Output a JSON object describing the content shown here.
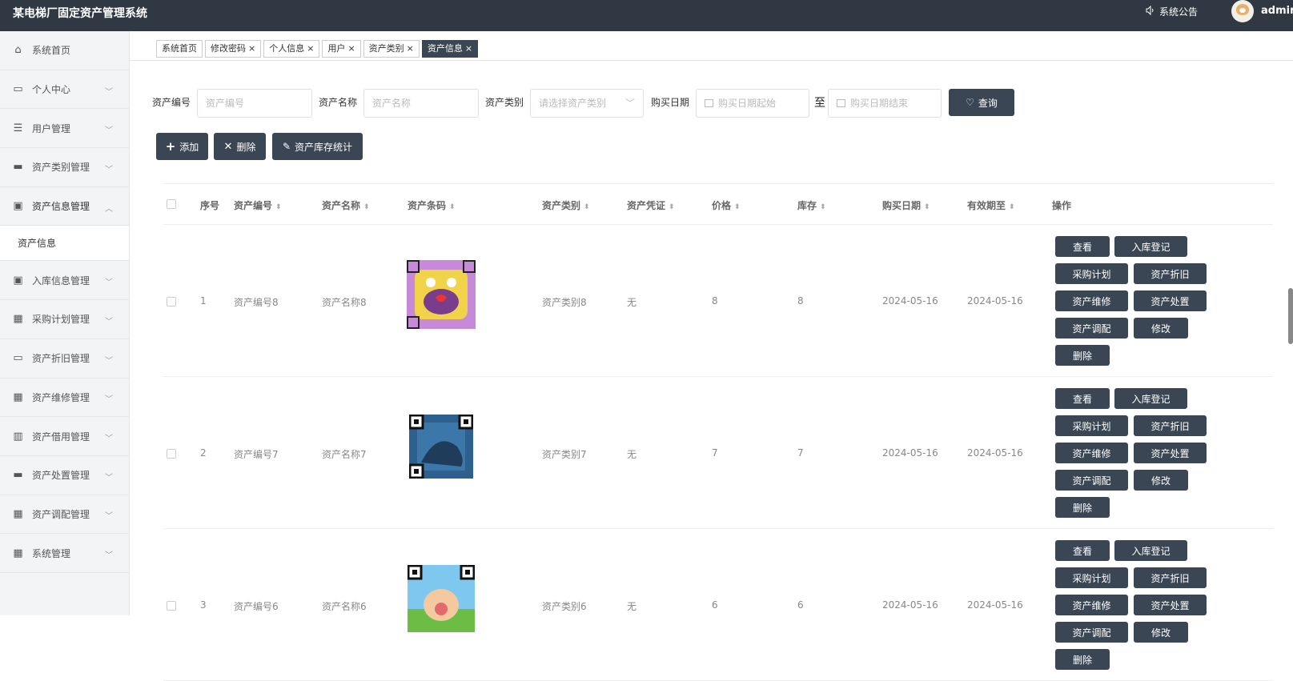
{
  "app_title": "某电梯厂固定资产管理系统",
  "header": {
    "notice_label": "系统公告",
    "username": "admin"
  },
  "sidebar": {
    "items": [
      {
        "label": "系统首页",
        "icon": "home-icon"
      },
      {
        "label": "个人中心",
        "icon": "card-icon"
      },
      {
        "label": "用户管理",
        "icon": "list-icon"
      },
      {
        "label": "资产类别管理",
        "icon": "chat-icon"
      },
      {
        "label": "资产信息管理",
        "icon": "clipboard-x-icon",
        "open": true,
        "sub": [
          "资产信息"
        ]
      },
      {
        "label": "入库信息管理",
        "icon": "clipboard-check-icon"
      },
      {
        "label": "采购计划管理",
        "icon": "grid-icon"
      },
      {
        "label": "资产折旧管理",
        "icon": "monitor-icon"
      },
      {
        "label": "资产维修管理",
        "icon": "grid-icon"
      },
      {
        "label": "资产借用管理",
        "icon": "bars-icon"
      },
      {
        "label": "资产处置管理",
        "icon": "ticket-icon"
      },
      {
        "label": "资产调配管理",
        "icon": "grid-icon"
      },
      {
        "label": "系统管理",
        "icon": "grid-icon"
      }
    ]
  },
  "tabs": [
    {
      "label": "系统首页",
      "closable": false,
      "active": false
    },
    {
      "label": "修改密码",
      "closable": true,
      "active": false
    },
    {
      "label": "个人信息",
      "closable": true,
      "active": false
    },
    {
      "label": "用户",
      "closable": true,
      "active": false
    },
    {
      "label": "资产类别",
      "closable": true,
      "active": false
    },
    {
      "label": "资产信息",
      "closable": true,
      "active": true
    }
  ],
  "search": {
    "code_label": "资产编号",
    "code_placeholder": "资产编号",
    "name_label": "资产名称",
    "name_placeholder": "资产名称",
    "type_label": "资产类别",
    "type_placeholder": "请选择资产类别",
    "date_label": "购买日期",
    "date_start_placeholder": "购买日期起始",
    "date_sep": "至",
    "date_end_placeholder": "购买日期结束",
    "query_button": "查询"
  },
  "toolbar": {
    "add": "添加",
    "delete": "删除",
    "stats": "资产库存统计"
  },
  "table": {
    "headers": [
      "序号",
      "资产编号",
      "资产名称",
      "资产条码",
      "资产类别",
      "资产凭证",
      "价格",
      "库存",
      "购买日期",
      "有效期至",
      "操作"
    ],
    "rows": [
      {
        "index": "1",
        "code": "资产编号8",
        "name": "资产名称8",
        "type": "资产类别8",
        "voucher": "无",
        "price": "8",
        "stock": "8",
        "buy_date": "2024-05-16",
        "expire": "2024-05-16"
      },
      {
        "index": "2",
        "code": "资产编号7",
        "name": "资产名称7",
        "type": "资产类别7",
        "voucher": "无",
        "price": "7",
        "stock": "7",
        "buy_date": "2024-05-16",
        "expire": "2024-05-16"
      },
      {
        "index": "3",
        "code": "资产编号6",
        "name": "资产名称6",
        "type": "资产类别6",
        "voucher": "无",
        "price": "6",
        "stock": "6",
        "buy_date": "2024-05-16",
        "expire": "2024-05-16"
      }
    ],
    "actions": [
      "查看",
      "入库登记",
      "采购计划",
      "资产折旧",
      "资产维修",
      "资产处置",
      "资产调配",
      "修改",
      "删除"
    ]
  },
  "colors": {
    "topbar": "#2f3843",
    "button": "#3b4654",
    "sidebar_bg": "#f3f4f6"
  }
}
